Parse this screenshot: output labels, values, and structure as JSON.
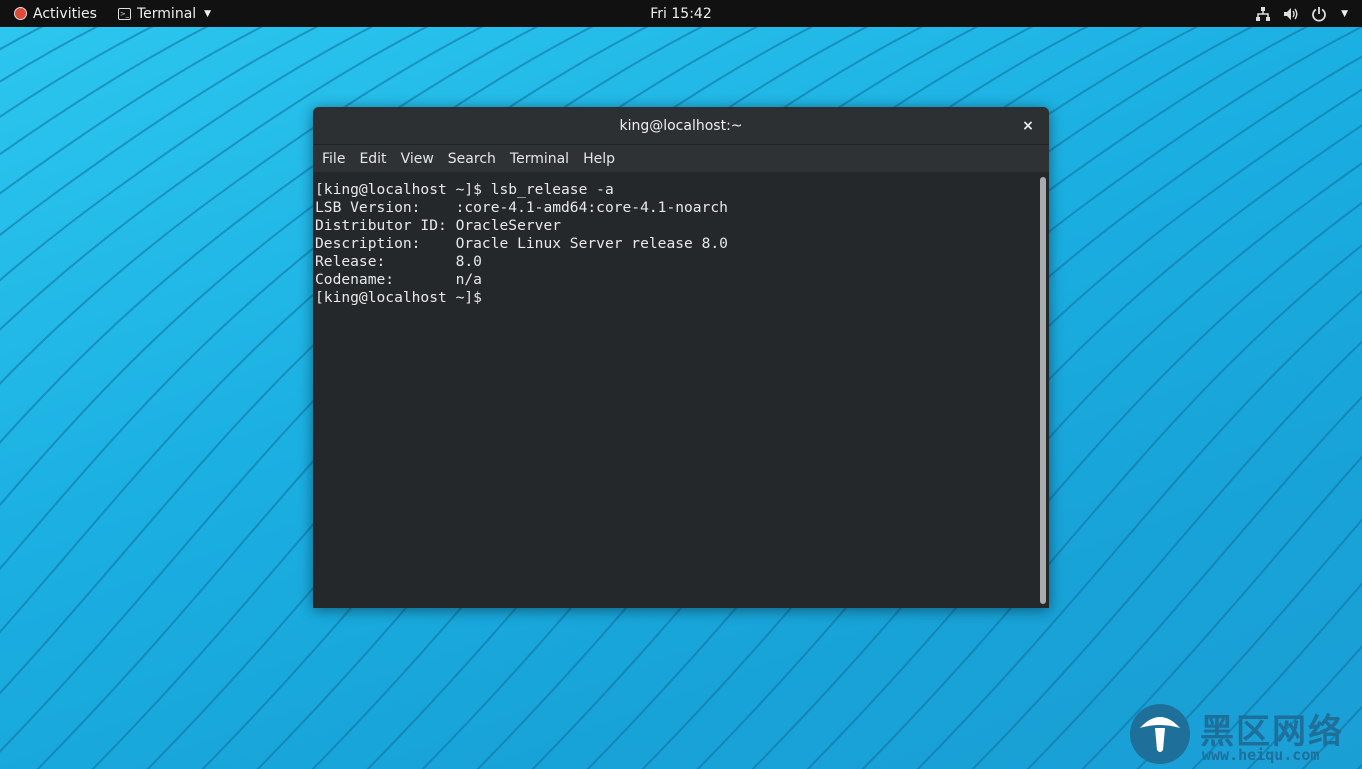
{
  "topbar": {
    "activities_label": "Activities",
    "app_menu_label": "Terminal",
    "clock": "Fri 15:42",
    "icons": [
      "network-icon",
      "volume-icon",
      "power-icon",
      "system-menu-caret-icon"
    ]
  },
  "terminal": {
    "title": "king@localhost:~",
    "close_glyph": "×",
    "menu": [
      "File",
      "Edit",
      "View",
      "Search",
      "Terminal",
      "Help"
    ],
    "lines": [
      "[king@localhost ~]$ lsb_release -a",
      "LSB Version:    :core-4.1-amd64:core-4.1-noarch",
      "Distributor ID: OracleServer",
      "Description:    Oracle Linux Server release 8.0",
      "Release:        8.0",
      "Codename:       n/a",
      "[king@localhost ~]$"
    ]
  },
  "watermark": {
    "name": "黑区网络",
    "url": "www.heiqu.com"
  },
  "colors": {
    "desktop": "#1fb3e4",
    "topbar": "#111111",
    "terminal_bg": "#25282b",
    "terminal_text": "#e8e8e8",
    "watermark": "#1e6f9a"
  }
}
